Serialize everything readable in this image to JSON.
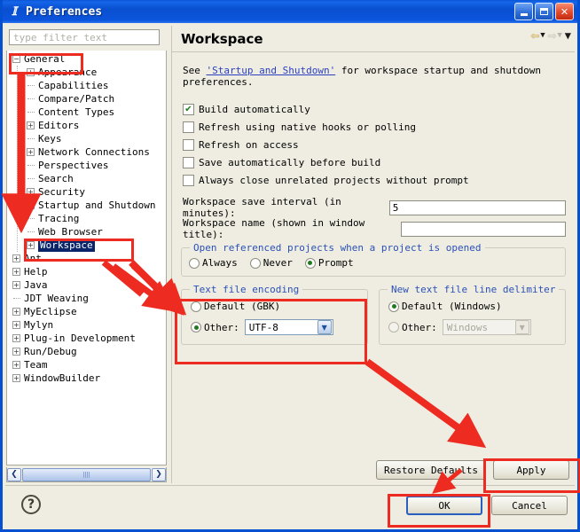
{
  "window": {
    "title": "Preferences",
    "icon": "eclipse-icon",
    "minimize_label": "Minimize",
    "maximize_label": "Maximize",
    "close_label": "Close"
  },
  "sidebar": {
    "filter_placeholder": "type filter text",
    "filter_value": "",
    "items": [
      {
        "label": "General",
        "depth": 0,
        "expander": "minus",
        "selected": false
      },
      {
        "label": "Appearance",
        "depth": 1,
        "expander": "plus",
        "selected": false
      },
      {
        "label": "Capabilities",
        "depth": 1,
        "expander": "none",
        "selected": false
      },
      {
        "label": "Compare/Patch",
        "depth": 1,
        "expander": "none",
        "selected": false
      },
      {
        "label": "Content Types",
        "depth": 1,
        "expander": "none",
        "selected": false
      },
      {
        "label": "Editors",
        "depth": 1,
        "expander": "plus",
        "selected": false
      },
      {
        "label": "Keys",
        "depth": 1,
        "expander": "none",
        "selected": false
      },
      {
        "label": "Network Connections",
        "depth": 1,
        "expander": "plus",
        "selected": false
      },
      {
        "label": "Perspectives",
        "depth": 1,
        "expander": "none",
        "selected": false
      },
      {
        "label": "Search",
        "depth": 1,
        "expander": "none",
        "selected": false
      },
      {
        "label": "Security",
        "depth": 1,
        "expander": "plus",
        "selected": false
      },
      {
        "label": "Startup and Shutdown",
        "depth": 1,
        "expander": "plus",
        "selected": false
      },
      {
        "label": "Tracing",
        "depth": 1,
        "expander": "none",
        "selected": false
      },
      {
        "label": "Web Browser",
        "depth": 1,
        "expander": "none",
        "selected": false
      },
      {
        "label": "Workspace",
        "depth": 1,
        "expander": "plus",
        "selected": true
      },
      {
        "label": "Ant",
        "depth": 0,
        "expander": "plus",
        "selected": false
      },
      {
        "label": "Help",
        "depth": 0,
        "expander": "plus",
        "selected": false
      },
      {
        "label": "Java",
        "depth": 0,
        "expander": "plus",
        "selected": false
      },
      {
        "label": "JDT Weaving",
        "depth": 0,
        "expander": "none",
        "selected": false
      },
      {
        "label": "MyEclipse",
        "depth": 0,
        "expander": "plus",
        "selected": false
      },
      {
        "label": "Mylyn",
        "depth": 0,
        "expander": "plus",
        "selected": false
      },
      {
        "label": "Plug-in Development",
        "depth": 0,
        "expander": "plus",
        "selected": false
      },
      {
        "label": "Run/Debug",
        "depth": 0,
        "expander": "plus",
        "selected": false
      },
      {
        "label": "Team",
        "depth": 0,
        "expander": "plus",
        "selected": false
      },
      {
        "label": "WindowBuilder",
        "depth": 0,
        "expander": "plus",
        "selected": false
      }
    ],
    "scroll_left_label": "❮",
    "scroll_right_label": "❯"
  },
  "page": {
    "title": "Workspace",
    "nav": {
      "back_label": "⇦",
      "back_caret": "▼",
      "forward_label": "⇨",
      "forward_caret": "▼",
      "menu_caret": "▼"
    },
    "intro": {
      "prefix": "See ",
      "link": "'Startup and Shutdown'",
      "suffix": " for workspace startup and shutdown preferences."
    },
    "checkboxes": [
      {
        "label": "Build automatically",
        "checked": true
      },
      {
        "label": "Refresh using native hooks or polling",
        "checked": false
      },
      {
        "label": "Refresh on access",
        "checked": false
      },
      {
        "label": "Save automatically before build",
        "checked": false
      },
      {
        "label": "Always close unrelated projects without prompt",
        "checked": false
      }
    ],
    "fields": [
      {
        "label": "Workspace save interval (in minutes):",
        "value": "5"
      },
      {
        "label": "Workspace name (shown in window title):",
        "value": ""
      }
    ],
    "open_referenced": {
      "group_label": "Open referenced projects when a project is opened",
      "options": [
        {
          "label": "Always",
          "selected": false
        },
        {
          "label": "Never",
          "selected": false
        },
        {
          "label": "Prompt",
          "selected": true
        }
      ]
    },
    "text_file_encoding": {
      "group_label": "Text file encoding",
      "default_option": {
        "label": "Default  (GBK)",
        "selected": false
      },
      "other_option": {
        "label": "Other:",
        "selected": true
      },
      "other_value": "UTF-8",
      "dropdown_caret": "▼"
    },
    "line_delimiter": {
      "group_label": "New text file line delimiter",
      "default_option": {
        "label": "Default (Windows)",
        "selected": true
      },
      "other_option": {
        "label": "Other:",
        "selected": false
      },
      "other_value": "Windows",
      "dropdown_caret": "▼"
    },
    "buttons": {
      "restore_defaults": "Restore Defaults",
      "apply": "Apply"
    }
  },
  "footer": {
    "help_label": "?",
    "ok": "OK",
    "cancel": "Cancel"
  },
  "annotations": {
    "color": "#ee2b20",
    "boxes": [
      {
        "name": "general-highlight"
      },
      {
        "name": "workspace-highlight"
      },
      {
        "name": "text-file-encoding-highlight"
      },
      {
        "name": "apply-highlight"
      },
      {
        "name": "ok-highlight"
      }
    ],
    "arrows": [
      {
        "name": "general-to-workspace-arrow"
      },
      {
        "name": "workspace-to-encoding-arrow"
      },
      {
        "name": "tree-to-right-arrow"
      },
      {
        "name": "encoding-to-apply-arrow"
      },
      {
        "name": "restore-to-ok-arrow"
      }
    ]
  }
}
